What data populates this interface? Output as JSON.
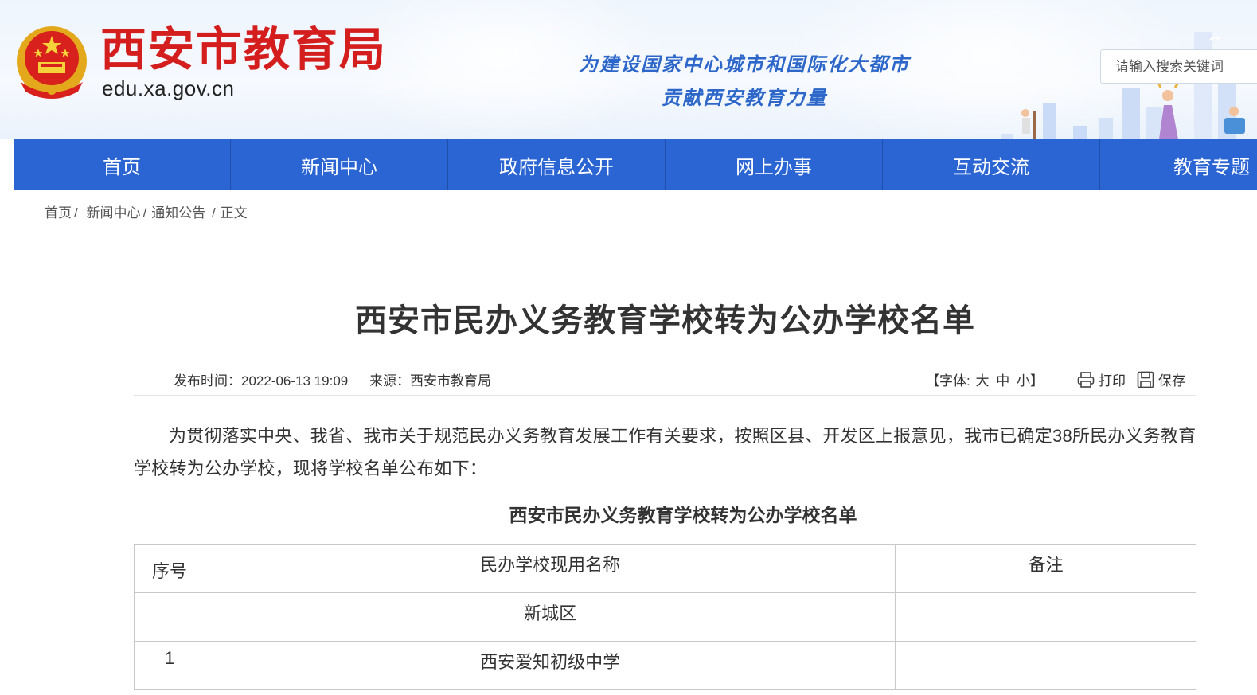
{
  "header": {
    "site_title": "西安市教育局",
    "site_url": "edu.xa.gov.cn",
    "slogan_line1": "为建设国家中心城市和国际化大都市",
    "slogan_line2": "贡献西安教育力量",
    "search_placeholder": "请输入搜索关键词",
    "emblem_icon": "national-emblem-icon"
  },
  "nav": {
    "items": [
      {
        "label": "首页"
      },
      {
        "label": "新闻中心"
      },
      {
        "label": "政府信息公开"
      },
      {
        "label": "网上办事"
      },
      {
        "label": "互动交流"
      },
      {
        "label": "教育专题"
      }
    ]
  },
  "breadcrumb": {
    "items": [
      "首页",
      "新闻中心",
      "通知公告",
      "正文"
    ],
    "separator": "/"
  },
  "article": {
    "title": "西安市民办义务教育学校转为公办学校名单",
    "publish_label": "发布时间：",
    "publish_time": "2022-06-13 19:09",
    "source_label": "来源：",
    "source": "西安市教育局",
    "font_label": "【字体:",
    "font_large": "大",
    "font_medium": "中",
    "font_small": "小】",
    "print_label": "打印",
    "save_label": "保存",
    "paragraph": "为贯彻落实中央、我省、我市关于规范民办义务教育发展工作有关要求，按照区县、开发区上报意见，我市已确定38所民办义务教育学校转为公办学校，现将学校名单公布如下：",
    "list_title": "西安市民办义务教育学校转为公办学校名单"
  },
  "table": {
    "headers": [
      "序号",
      "民办学校现用名称",
      "备注"
    ],
    "rows": [
      [
        "",
        "新城区",
        ""
      ],
      [
        "1",
        "西安爱知初级中学",
        ""
      ]
    ]
  },
  "colors": {
    "nav_bg": "#2b65d4",
    "title_red": "#d41e1e",
    "slogan_blue": "#2c67c9"
  }
}
